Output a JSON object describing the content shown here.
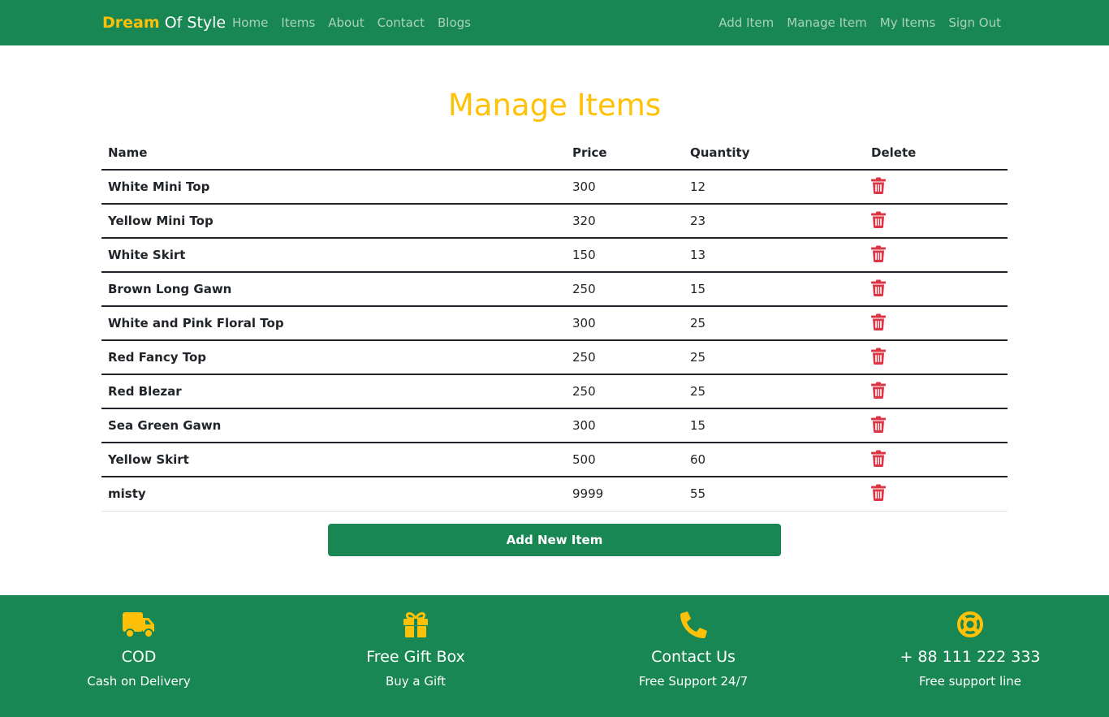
{
  "navbar": {
    "brand_part1": "Dream",
    "brand_part2": "Of Style",
    "left_links": [
      "Home",
      "Items",
      "About",
      "Contact",
      "Blogs"
    ],
    "right_links": [
      "Add Item",
      "Manage Item",
      "My Items",
      "Sign Out"
    ]
  },
  "main": {
    "title": "Manage Items",
    "table": {
      "headers": [
        "Name",
        "Price",
        "Quantity",
        "Delete"
      ],
      "rows": [
        {
          "name": "White Mini Top",
          "price": "300",
          "quantity": "12"
        },
        {
          "name": "Yellow Mini Top",
          "price": "320",
          "quantity": "23"
        },
        {
          "name": "White Skirt",
          "price": "150",
          "quantity": "13"
        },
        {
          "name": "Brown Long Gawn",
          "price": "250",
          "quantity": "15"
        },
        {
          "name": "White and Pink Floral Top",
          "price": "300",
          "quantity": "25"
        },
        {
          "name": "Red Fancy Top",
          "price": "250",
          "quantity": "25"
        },
        {
          "name": "Red Blezar",
          "price": "250",
          "quantity": "25"
        },
        {
          "name": "Sea Green Gawn",
          "price": "300",
          "quantity": "15"
        },
        {
          "name": "Yellow Skirt",
          "price": "500",
          "quantity": "60"
        },
        {
          "name": "misty",
          "price": "9999",
          "quantity": "55"
        }
      ],
      "delete_icon": "trash-icon"
    },
    "add_button_label": "Add New Item"
  },
  "footer": {
    "features": [
      {
        "icon": "truck-icon",
        "title": "COD",
        "subtitle": "Cash on Delivery"
      },
      {
        "icon": "gift-icon",
        "title": "Free Gift Box",
        "subtitle": "Buy a Gift"
      },
      {
        "icon": "phone-icon",
        "title": "Contact Us",
        "subtitle": "Free Support 24/7"
      },
      {
        "icon": "lifebuoy-icon",
        "title": "+ 88 111 222 333",
        "subtitle": "Free support line"
      }
    ]
  },
  "colors": {
    "primary_green": "#198754",
    "accent_yellow": "#ffc107",
    "danger_red": "#dc3545",
    "text_dark": "#212529"
  }
}
